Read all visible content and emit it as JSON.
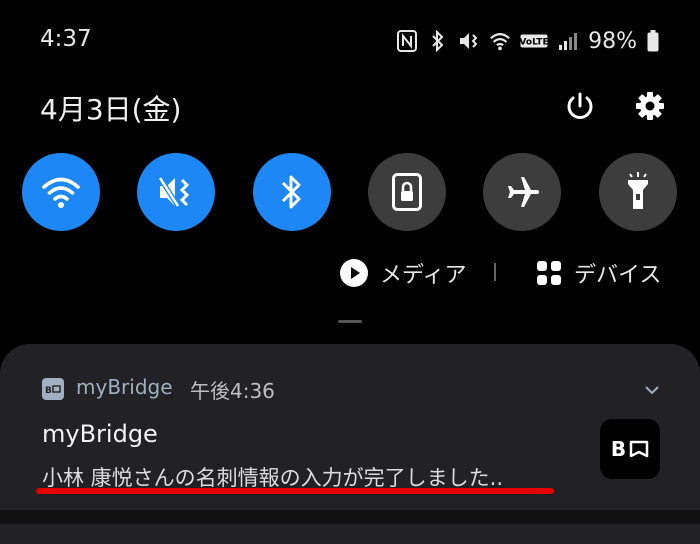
{
  "status_bar": {
    "time": "4:37",
    "battery": "98%",
    "icons": [
      "nfc-icon",
      "bluetooth-icon",
      "vibrate-mute-icon",
      "wifi-icon",
      "volte-icon",
      "signal-icon",
      "battery-icon"
    ],
    "volte_label": "VoLTE"
  },
  "header": {
    "date": "4月3日(金)",
    "buttons": [
      "power-icon",
      "settings-icon"
    ]
  },
  "quick_settings": {
    "tiles": [
      {
        "name": "wifi",
        "icon": "wifi-icon",
        "active": true
      },
      {
        "name": "vibrate",
        "icon": "vibrate-icon",
        "active": true
      },
      {
        "name": "bluetooth",
        "icon": "bluetooth-icon",
        "active": true
      },
      {
        "name": "screen-lock",
        "icon": "lock-icon",
        "active": false
      },
      {
        "name": "airplane",
        "icon": "airplane-icon",
        "active": false
      },
      {
        "name": "flashlight",
        "icon": "flashlight-icon",
        "active": false
      }
    ],
    "active_color": "#1c87f5",
    "inactive_color": "#3d3d3d"
  },
  "media_row": {
    "media_label": "メディア",
    "devices_label": "デバイス"
  },
  "notification": {
    "app_name": "myBridge",
    "time": "午後4:36",
    "title": "myBridge",
    "body": "小林 康悦さんの名刺情報の入力が完了しました..",
    "large_icon_text": "B",
    "accent_color": "#9fb0c2",
    "highlight_color": "#e50000"
  }
}
